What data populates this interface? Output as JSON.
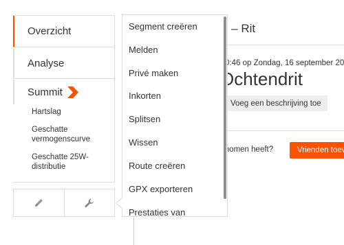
{
  "sidebar": {
    "items": [
      {
        "label": "Overzicht",
        "active": true
      },
      {
        "label": "Analyse",
        "active": false
      },
      {
        "label": "Summit",
        "active": false,
        "icon": "summit-chevron-icon"
      }
    ],
    "sub_items": [
      {
        "label": "Hartslag"
      },
      {
        "label": "Geschatte vermogenscurve"
      },
      {
        "label": "Geschatte 25W-distributie"
      }
    ],
    "tools": [
      {
        "icon": "pencil-icon"
      },
      {
        "icon": "wrench-icon"
      }
    ]
  },
  "main": {
    "title": "g – Rit",
    "date": "0:46 op Zondag, 16 september 20",
    "activity_name": "Ochtendrit",
    "add_description_label": "Voeg een beschrijving toe",
    "question": "genomen heeft?",
    "invite_label": "Vrienden toev"
  },
  "dropdown": {
    "items": [
      {
        "label": "Segment creëren"
      },
      {
        "label": "Melden"
      },
      {
        "label": "Privé maken"
      },
      {
        "label": "Inkorten"
      },
      {
        "label": "Splitsen"
      },
      {
        "label": "Wissen"
      },
      {
        "label": "Route creëren"
      },
      {
        "label": "GPX exporteren"
      },
      {
        "label": "Prestaties van"
      }
    ]
  },
  "colors": {
    "accent": "#fc5200",
    "border": "#dddddd",
    "text": "#333333",
    "button_bg": "#eeeeee"
  }
}
